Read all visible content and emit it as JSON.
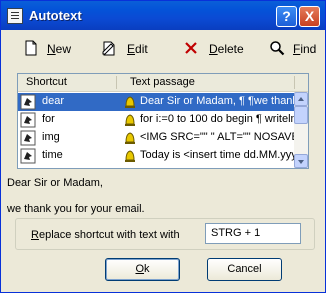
{
  "window": {
    "title": "Autotext"
  },
  "titlebar": {
    "help_label": "?",
    "close_label": "X"
  },
  "toolbar": {
    "new_label": "ew",
    "new_mnemonic": "N",
    "edit_label": "dit",
    "edit_mnemonic": "E",
    "delete_label": "elete",
    "delete_mnemonic": "D",
    "find_label": "ind",
    "find_mnemonic": "F"
  },
  "list": {
    "columns": [
      "Shortcut",
      "Text passage"
    ],
    "rows": [
      {
        "shortcut": "dear",
        "text": "Dear Sir or Madam, ¶ ¶we thank",
        "selected": true
      },
      {
        "shortcut": "for",
        "text": "for i:=0 to 100 do begin ¶ writeln",
        "selected": false
      },
      {
        "shortcut": "img",
        "text": "<IMG SRC=\"\" \" ALT=\"\" NOSAVE",
        "selected": false
      },
      {
        "shortcut": "time",
        "text": "Today is <insert time dd.MM.yyyy",
        "selected": false
      }
    ]
  },
  "preview": {
    "line1": "Dear Sir or Madam,",
    "line2": "we thank you for your email."
  },
  "replace": {
    "label_mnemonic": "R",
    "label_rest": "eplace shortcut with text with",
    "value": "STRG + 1"
  },
  "buttons": {
    "ok_mnemonic": "O",
    "ok_rest": "k",
    "cancel_label": "Cancel"
  },
  "colors": {
    "titlebar": "#0a5fd8",
    "selection": "#316ac5",
    "dialog_bg": "#ece9d8"
  },
  "icons": {
    "new": "new-document-icon",
    "edit": "edit-icon",
    "delete": "delete-x-icon",
    "find": "magnifier-icon",
    "shortcut": "shortcut-hand-icon",
    "text": "bell-icon"
  }
}
